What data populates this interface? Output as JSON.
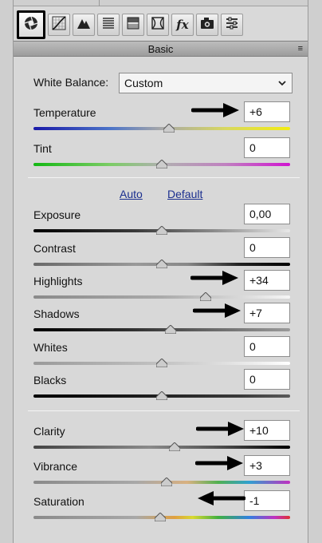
{
  "toolbar": {
    "icons": [
      "aperture-icon",
      "tone-curve-icon",
      "detail-icon",
      "hsl-icon",
      "split-toning-icon",
      "lens-corrections-icon",
      "effects-fx-icon",
      "camera-calibration-icon",
      "presets-icon"
    ],
    "fx_label": "fx"
  },
  "panel": {
    "title": "Basic",
    "menu_glyph": "≡"
  },
  "white_balance": {
    "label": "White Balance:",
    "value": "Custom"
  },
  "links": {
    "auto": "Auto",
    "default": "Default"
  },
  "sliders": {
    "temperature": {
      "label": "Temperature",
      "value": "+6"
    },
    "tint": {
      "label": "Tint",
      "value": "0"
    },
    "exposure": {
      "label": "Exposure",
      "value": "0,00"
    },
    "contrast": {
      "label": "Contrast",
      "value": "0"
    },
    "highlights": {
      "label": "Highlights",
      "value": "+34"
    },
    "shadows": {
      "label": "Shadows",
      "value": "+7"
    },
    "whites": {
      "label": "Whites",
      "value": "0"
    },
    "blacks": {
      "label": "Blacks",
      "value": "0"
    },
    "clarity": {
      "label": "Clarity",
      "value": "+10"
    },
    "vibrance": {
      "label": "Vibrance",
      "value": "+3"
    },
    "saturation": {
      "label": "Saturation",
      "value": "-1"
    }
  },
  "colors": {
    "annotation_arrow": "#000000",
    "link": "#1b2f8f",
    "panel_bg": "#d8d8d8"
  }
}
